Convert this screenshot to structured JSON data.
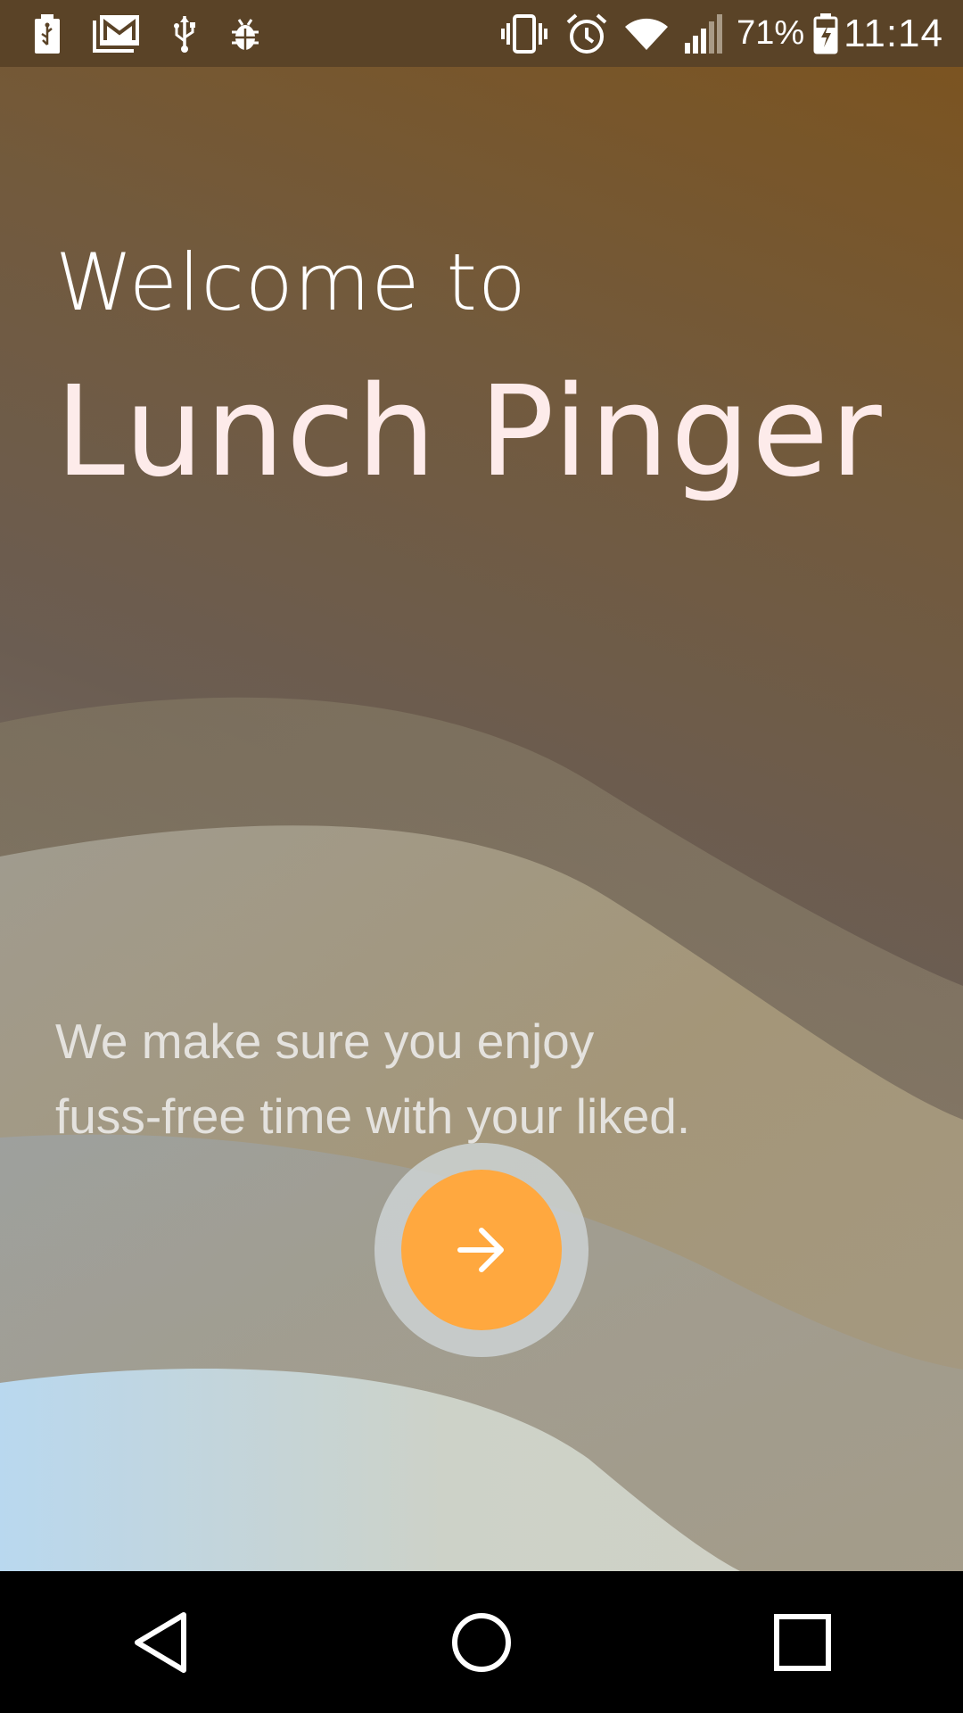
{
  "status_bar": {
    "left_icons": [
      "battery-usb-icon",
      "gmail-icon",
      "usb-icon",
      "bug-icon"
    ],
    "right_icons": [
      "vibrate-icon",
      "alarm-icon",
      "wifi-icon",
      "signal-icon"
    ],
    "battery_percent": "71%",
    "battery_icon": "battery-charging-icon",
    "time": "11:14"
  },
  "welcome": {
    "line1": "Welcome to",
    "app_name": "Lunch Pinger",
    "tagline_line1": "We make sure you enjoy",
    "tagline_line2": "fuss-free time with your liked."
  },
  "next_button": {
    "icon": "arrow-right-icon"
  },
  "nav_bar": {
    "back_icon": "back-triangle-icon",
    "home_icon": "home-circle-icon",
    "recents_icon": "recents-square-icon"
  },
  "colors": {
    "status_bar_bg": "#5a4327",
    "accent": "#ffa83f",
    "app_name": "#fdebea",
    "tagline": "#e4e2de",
    "nav_bar_bg": "#000000"
  }
}
